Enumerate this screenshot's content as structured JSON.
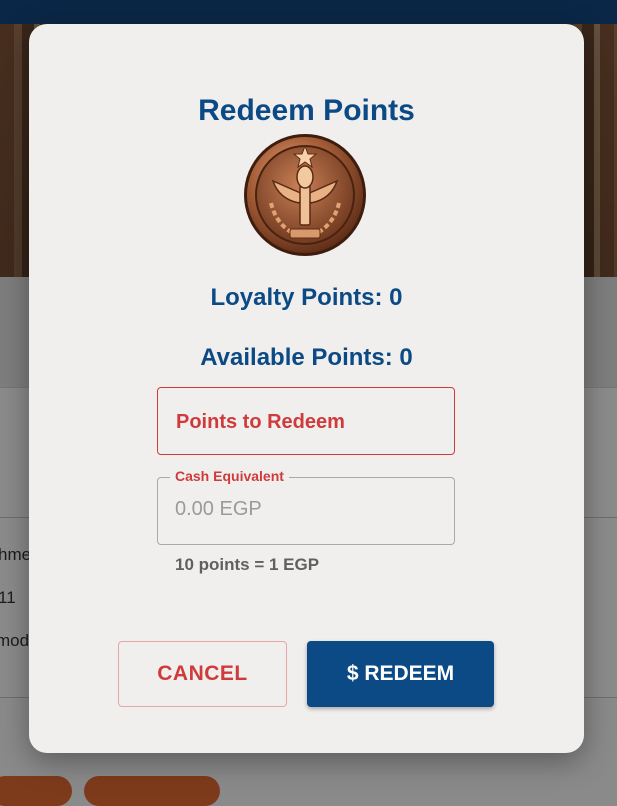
{
  "background": {
    "fragments": [
      "hme",
      "11",
      "moda"
    ]
  },
  "modal": {
    "title": "Redeem Points",
    "medal_icon": "bronze-medal-icon",
    "loyalty_points": "Loyalty Points: 0",
    "available_points": "Available Points: 0",
    "points_field": {
      "label": "Points to Redeem"
    },
    "cash_field": {
      "label": "Cash Equivalent",
      "placeholder": "0.00 EGP"
    },
    "conversion_hint": "10 points = 1 EGP",
    "cancel_label": "CANCEL",
    "redeem_label": "$ REDEEM"
  },
  "colors": {
    "primary": "#0b4a85",
    "error": "#cf3b3b",
    "modal_bg": "#f1efee"
  }
}
